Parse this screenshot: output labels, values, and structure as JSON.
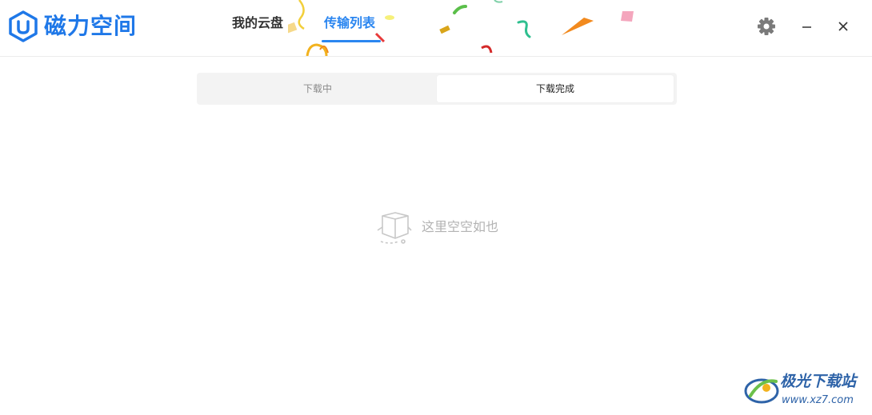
{
  "app": {
    "title": "磁力空间",
    "logo_icon": "hexagon-u-logo-icon",
    "brand_color": "#1f78e8"
  },
  "nav": {
    "tabs": [
      {
        "label": "我的云盘",
        "active": false
      },
      {
        "label": "传输列表",
        "active": true
      }
    ],
    "active_color": "#2b86f0"
  },
  "window_controls": {
    "settings_icon": "gear-icon",
    "minimize_icon": "minimize-icon",
    "close_icon": "close-icon"
  },
  "transfer": {
    "segments": [
      {
        "label": "下载中",
        "selected": false
      },
      {
        "label": "下载完成",
        "selected": true
      }
    ]
  },
  "empty_state": {
    "icon": "empty-box-icon",
    "message": "这里空空如也"
  },
  "watermark": {
    "name": "极光下载站",
    "url": "www.xz7.com"
  }
}
